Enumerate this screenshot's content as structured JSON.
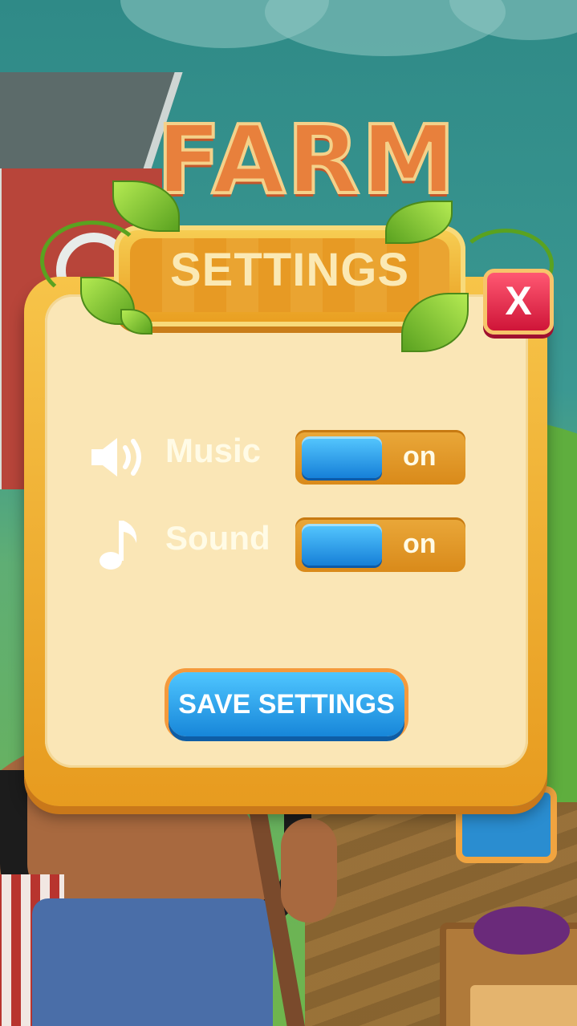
{
  "background": {
    "title": "FARM"
  },
  "dialog": {
    "title": "SETTINGS",
    "close_label": "X",
    "rows": [
      {
        "label": "Music",
        "icon": "speaker-icon",
        "state": "on"
      },
      {
        "label": "Sound",
        "icon": "music-note-icon",
        "state": "on"
      }
    ],
    "save_label": "SAVE SETTINGS"
  },
  "colors": {
    "frame": "#f2b233",
    "panel": "#fae6b6",
    "toggle_knob": "#2a9ee8",
    "close_button": "#e0203f",
    "save_button": "#2a9ee8"
  }
}
